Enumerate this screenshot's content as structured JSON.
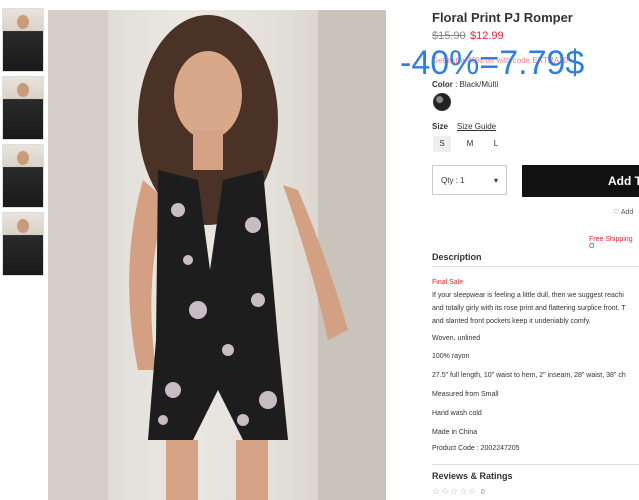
{
  "product": {
    "title": "Floral Print PJ Romper",
    "price_old": "$15.90",
    "price_new": "$12.99",
    "promo_text": "Get extra 40% off with code EXTRA30",
    "overlay": "-40%=7.79$"
  },
  "color": {
    "label": "Color",
    "value": " : Black/Multi"
  },
  "size": {
    "label": "Size",
    "guide": "Size Guide",
    "options": [
      "S",
      "M",
      "L"
    ],
    "selected": "S"
  },
  "qty": {
    "label": "Qty : 1",
    "arrow": "▾"
  },
  "add_button": "Add T",
  "wishlist": "♡ Add",
  "shipping": "Free Shipping O",
  "description": {
    "heading": "Description",
    "final_sale": "Final Sale",
    "lines": [
      "If your sleepwear is feeling a little dull, then we suggest reachi",
      "and totally girly with its rose print and flattering surplice front. T",
      "and slanted front pockets keep it undeniably comfy.",
      "Woven, unlined",
      "100% rayon",
      "27.5\" full length, 10\" waist to hem, 2\" inseam, 28\" waist, 38\" ch",
      "Measured from Small",
      "Hand wash cold",
      "Made in China",
      "Product Code : 2002247205"
    ]
  },
  "reviews": {
    "heading": "Reviews & Ratings",
    "stars": "☆☆☆☆☆",
    "count": "0"
  },
  "colors": {
    "sale_red": "#e0263b",
    "overlay_blue": "#2d7fe0",
    "button_black": "#111111"
  }
}
